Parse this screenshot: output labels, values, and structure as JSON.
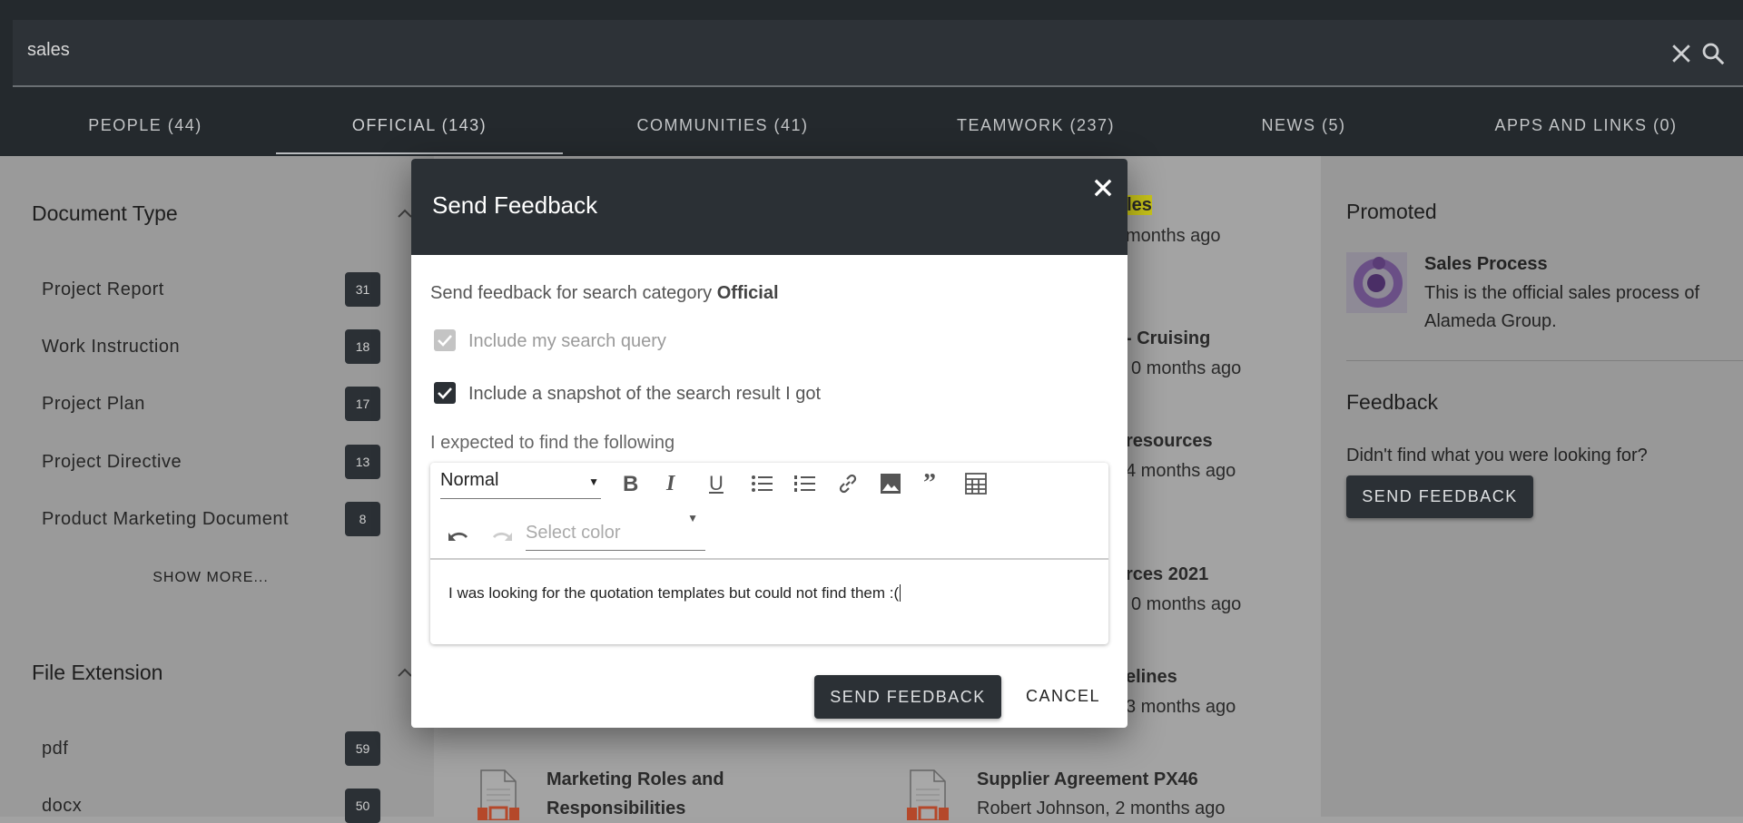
{
  "search": {
    "query": "sales"
  },
  "tabs": [
    {
      "label": "PEOPLE (44)"
    },
    {
      "label": "OFFICIAL (143)",
      "active": true
    },
    {
      "label": "COMMUNITIES (41)"
    },
    {
      "label": "TEAMWORK (237)"
    },
    {
      "label": "NEWS (5)"
    },
    {
      "label": "APPS AND LINKS (0)"
    }
  ],
  "sidebar": {
    "document_type": {
      "title": "Document Type",
      "items": [
        {
          "label": "Project Report",
          "count": "31"
        },
        {
          "label": "Work Instruction",
          "count": "18"
        },
        {
          "label": "Project Plan",
          "count": "17"
        },
        {
          "label": "Project Directive",
          "count": "13"
        },
        {
          "label": "Product Marketing Document",
          "count": "8"
        }
      ],
      "show_more": "SHOW MORE..."
    },
    "file_extension": {
      "title": "File Extension",
      "items": [
        {
          "label": "pdf",
          "count": "59"
        },
        {
          "label": "docx",
          "count": "50"
        }
      ]
    }
  },
  "results_fragments": [
    "ales",
    "months ago",
    "- Cruising",
    "0 months ago",
    "resources",
    "4 months ago",
    "rces 2021",
    "0 months ago",
    "elines",
    "3 months ago"
  ],
  "results_bottom": [
    {
      "title_line1": "Marketing Roles and",
      "title_line2": "Responsibilities"
    },
    {
      "title_line1": "Supplier Agreement PX46",
      "meta": "Robert Johnson, 2 months ago"
    }
  ],
  "right": {
    "promoted_title": "Promoted",
    "promoted_item": {
      "title": "Sales Process",
      "desc_line1": "This is the official sales process of",
      "desc_line2": "Alameda Group."
    },
    "feedback_title": "Feedback",
    "feedback_prompt": "Didn't find what you were looking for?",
    "feedback_button": "SEND FEEDBACK"
  },
  "modal": {
    "title": "Send Feedback",
    "intro": "Send feedback for search category ",
    "category": "Official",
    "checkbox_query": {
      "label": "Include my search query",
      "checked": true,
      "disabled": true
    },
    "checkbox_snapshot": {
      "label": "Include a snapshot of the search result I got",
      "checked": true
    },
    "expected_label": "I expected to find the following",
    "format_select": "Normal",
    "color_placeholder": "Select color",
    "editor_text": "I was looking for the quotation templates but could not find them :(",
    "send_button": "SEND FEEDBACK",
    "cancel_button": "CANCEL"
  },
  "colors": {
    "dark": "#2b3035",
    "highlight": "#c9c51a",
    "doc_icon_accent": "#b5482a"
  }
}
